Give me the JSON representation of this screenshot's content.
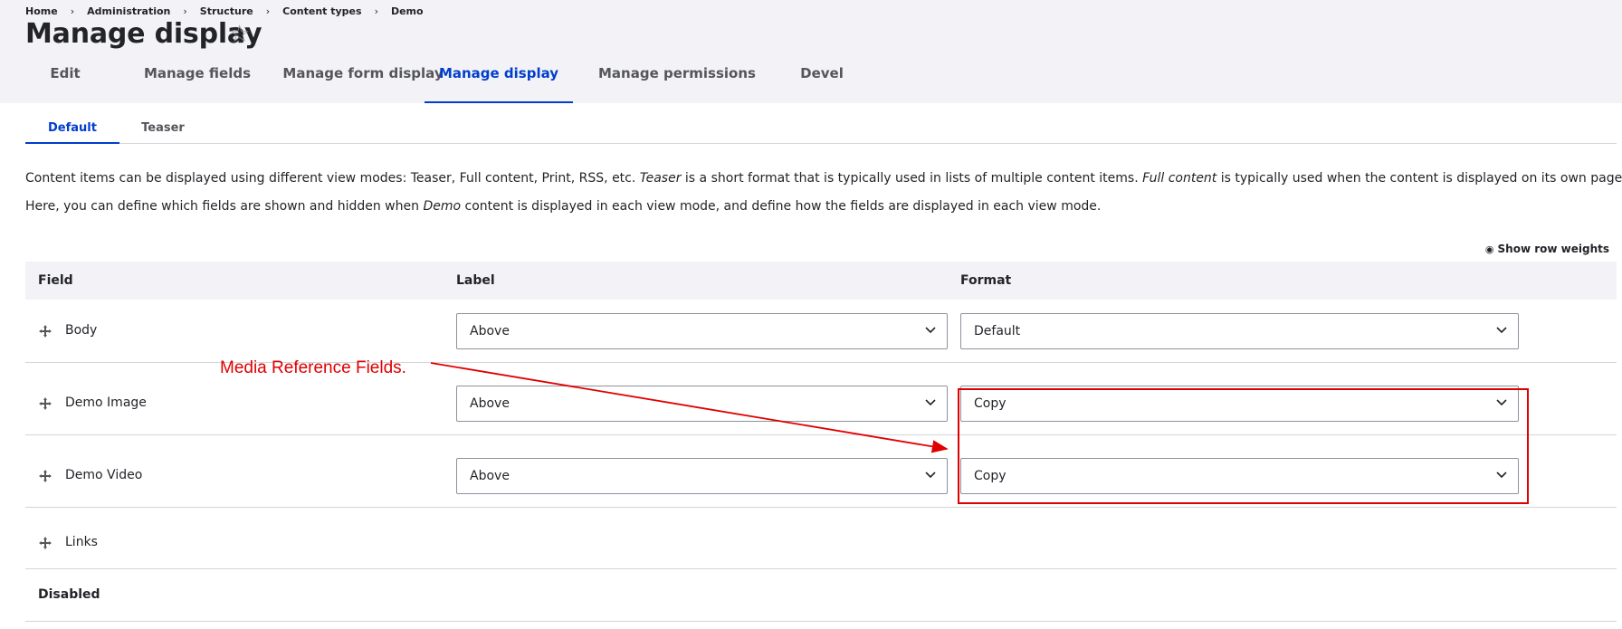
{
  "breadcrumb": [
    "Home",
    "Administration",
    "Structure",
    "Content types",
    "Demo"
  ],
  "page_title": "Manage display",
  "icons": {
    "favorite": "star-icon",
    "drag": "move-arrows-icon",
    "dropdown": "chevron-down-icon",
    "row_weights": "eye-icon"
  },
  "tabs": [
    {
      "label": "Edit",
      "active": false
    },
    {
      "label": "Manage fields",
      "active": false
    },
    {
      "label": "Manage form display",
      "active": false
    },
    {
      "label": "Manage display",
      "active": true
    },
    {
      "label": "Manage permissions",
      "active": false
    },
    {
      "label": "Devel",
      "active": false
    }
  ],
  "subtabs": [
    {
      "label": "Default",
      "active": true
    },
    {
      "label": "Teaser",
      "active": false
    }
  ],
  "description": {
    "p1_a": "Content items can be displayed using different view modes: Teaser, Full content, Print, RSS, etc. ",
    "p1_teaser": "Teaser",
    "p1_b": " is a short format that is typically used in lists of multiple content items. ",
    "p1_full": "Full content",
    "p1_c": " is typically used when the content is displayed on its own page.",
    "p2_a": "Here, you can define which fields are shown and hidden when ",
    "p2_demo": "Demo",
    "p2_b": " content is displayed in each view mode, and define how the fields are displayed in each view mode."
  },
  "show_row_weights": "Show row weights",
  "table": {
    "headers": {
      "field": "Field",
      "label": "Label",
      "format": "Format"
    },
    "rows": [
      {
        "field": "Body",
        "label": "Above",
        "format": "Default"
      },
      {
        "field": "Demo Image",
        "label": "Above",
        "format": "Copy"
      },
      {
        "field": "Demo Video",
        "label": "Above",
        "format": "Copy"
      },
      {
        "field": "Links"
      }
    ],
    "disabled_section": "Disabled"
  },
  "annotation": {
    "text": "Media Reference Fields.",
    "color": "#e00000"
  },
  "colors": {
    "accent": "#003ecc",
    "header_bg": "#f3f3f7",
    "border": "#d3d4d9"
  }
}
